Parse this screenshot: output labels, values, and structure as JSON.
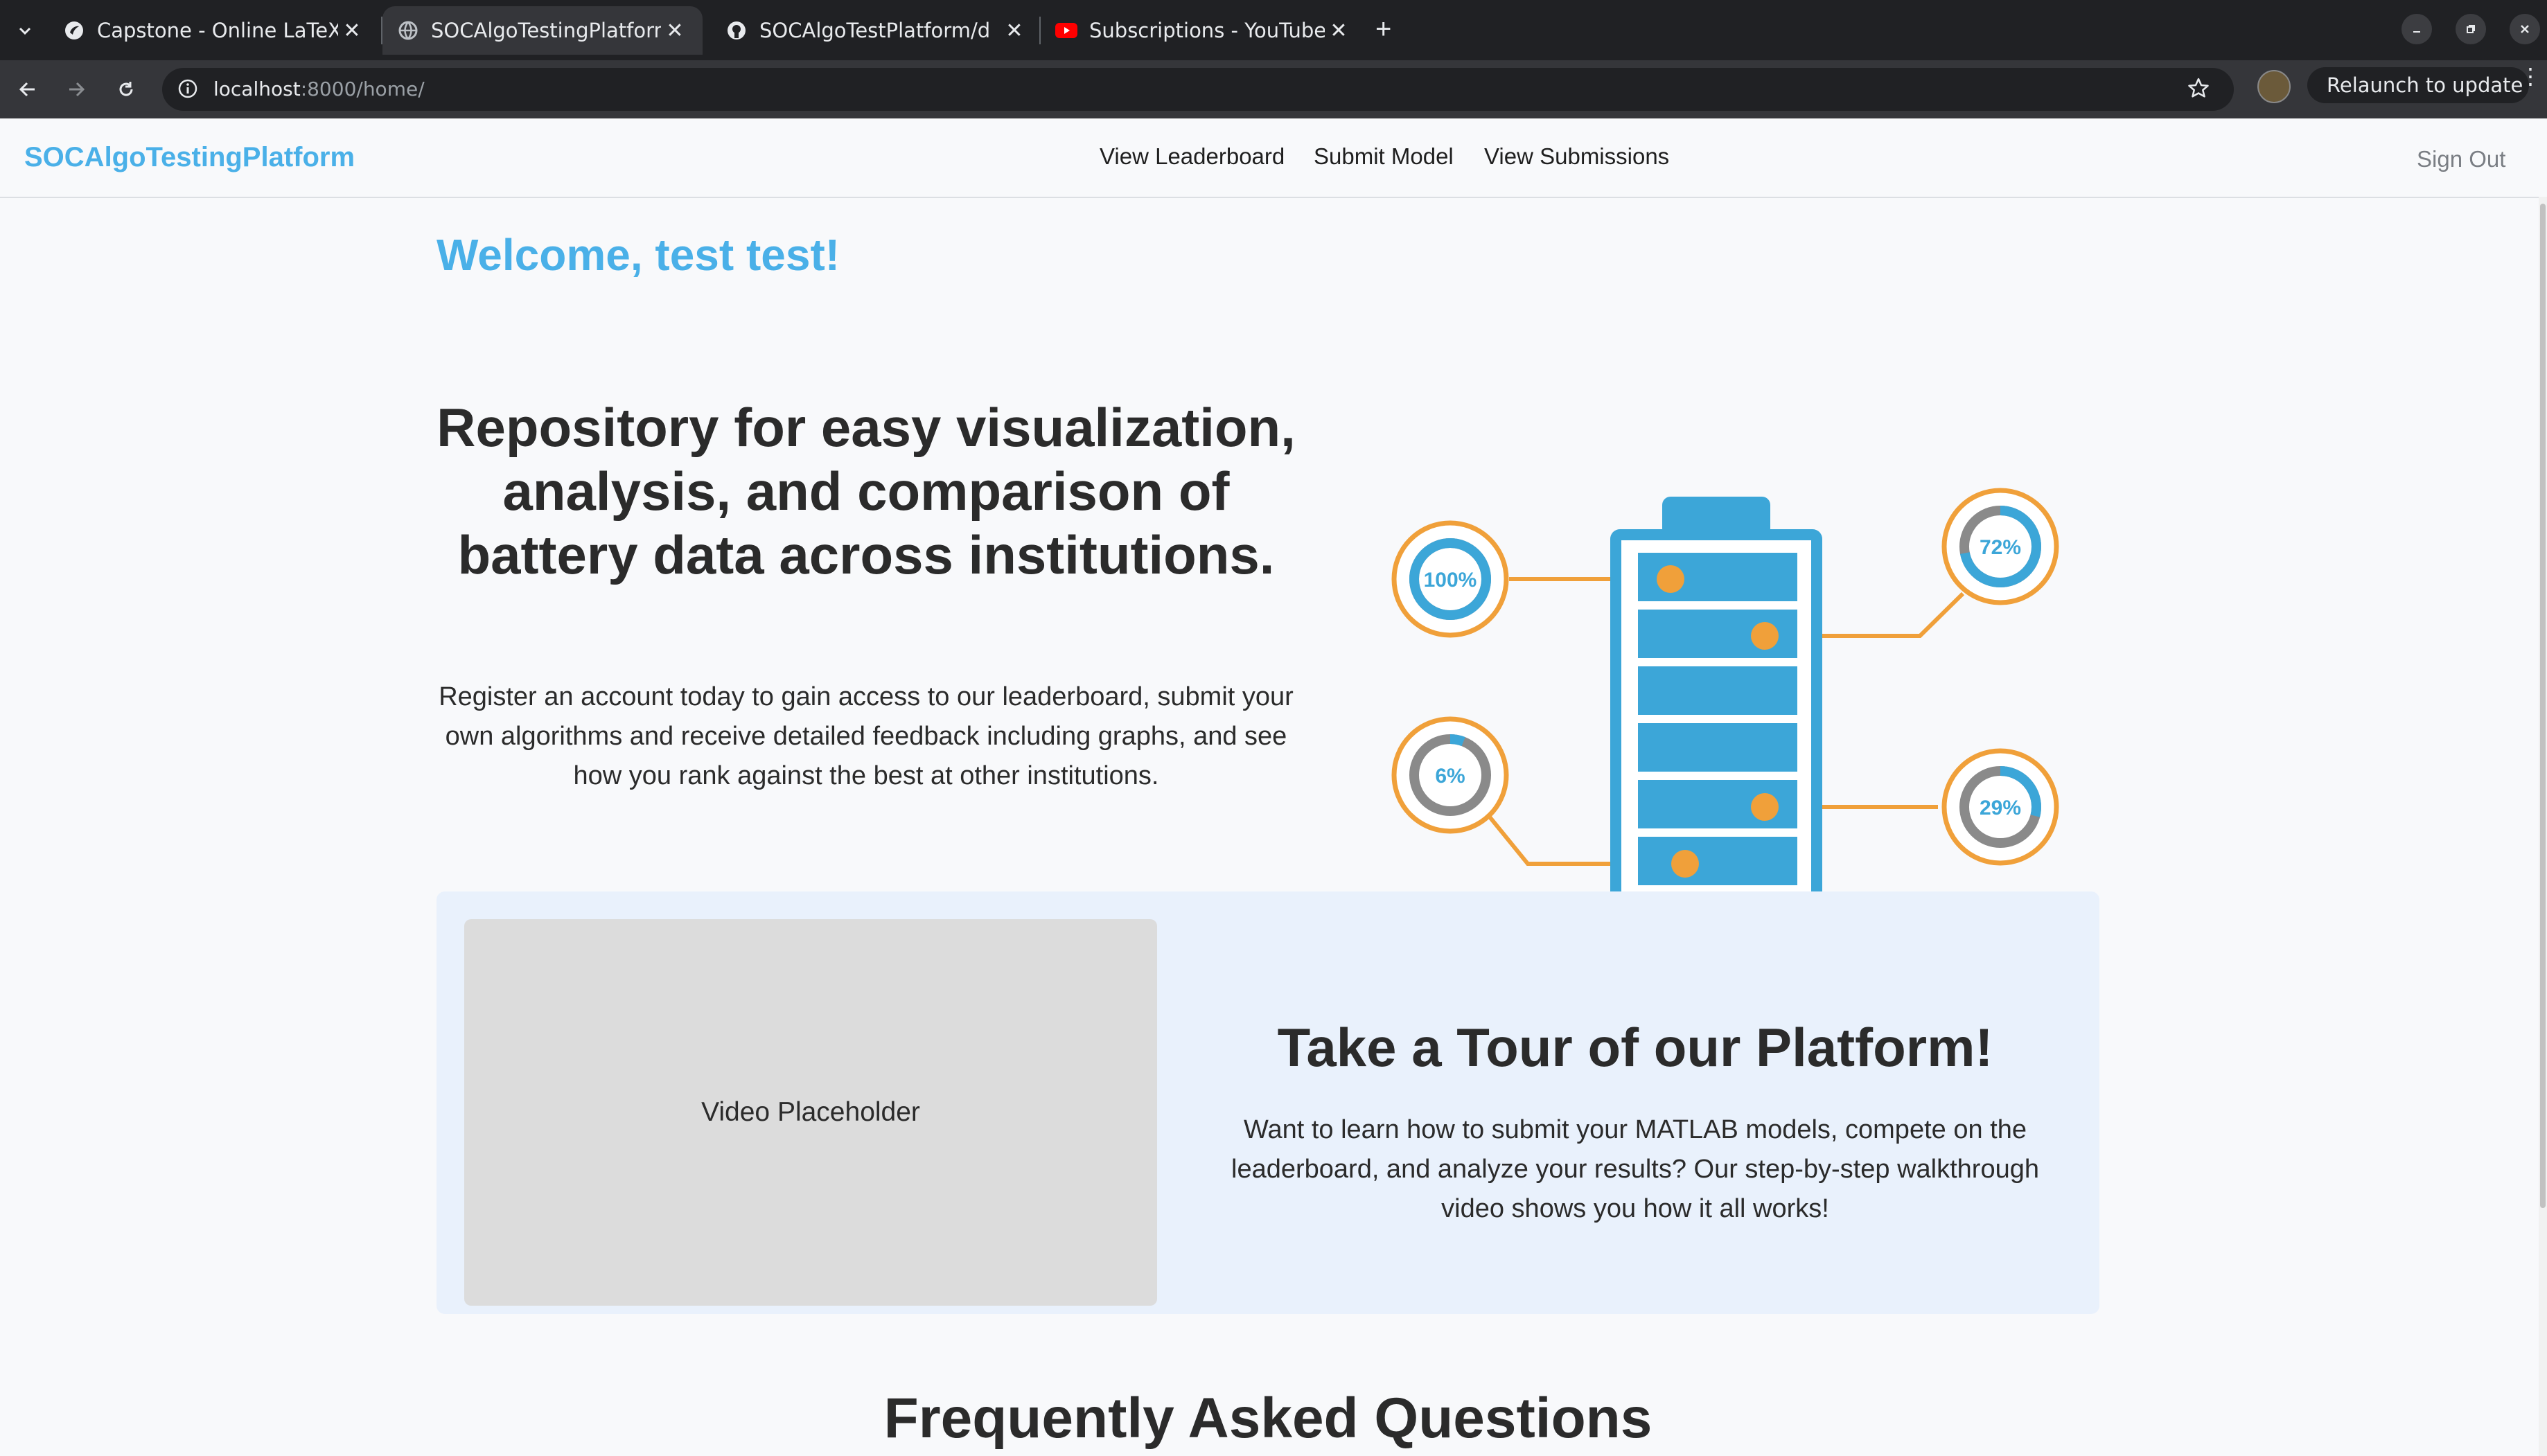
{
  "browser": {
    "tabs": [
      {
        "title": "Capstone - Online LaTeX",
        "icon": "overleaf-icon"
      },
      {
        "title": "SOCAlgoTestingPlatform",
        "icon": "globe-icon",
        "active": true
      },
      {
        "title": "SOCAlgoTestPlatform/d",
        "icon": "github-icon"
      },
      {
        "title": "Subscriptions - YouTube",
        "icon": "youtube-icon"
      }
    ],
    "url_host": "localhost",
    "url_path": ":8000/home/",
    "relaunch_label": "Relaunch to update"
  },
  "nav": {
    "brand": "SOCAlgoTestingPlatform",
    "links": [
      "View Leaderboard",
      "Submit Model",
      "View Submissions"
    ],
    "sign_out": "Sign Out"
  },
  "hero": {
    "welcome": "Welcome, test test!",
    "title": "Repository for easy visualization, analysis, and comparison of battery data across institutions.",
    "text": "Register an account today to gain access to our leaderboard, submit your own algorithms and receive detailed feedback including graphs, and see how you rank against the best at other institutions."
  },
  "battery_graphic": {
    "gauges": [
      {
        "label": "100%",
        "value": 1.0
      },
      {
        "label": "72%",
        "value": 0.72
      },
      {
        "label": "6%",
        "value": 0.06
      },
      {
        "label": "29%",
        "value": 0.29
      }
    ],
    "colors": {
      "blue": "#3ca6d8",
      "orange": "#f0a03a",
      "gray": "#8a8a8a"
    }
  },
  "tour": {
    "video_placeholder": "Video Placeholder",
    "title": "Take a Tour of our Platform!",
    "text": "Want to learn how to submit your MATLAB models, compete on the leaderboard, and analyze your results? Our step-by-step walkthrough video shows you how it all works!"
  },
  "faq": {
    "title": "Frequently Asked Questions"
  },
  "colors": {
    "accent": "#4ab0e8",
    "section_bg": "#e9f1fc"
  }
}
